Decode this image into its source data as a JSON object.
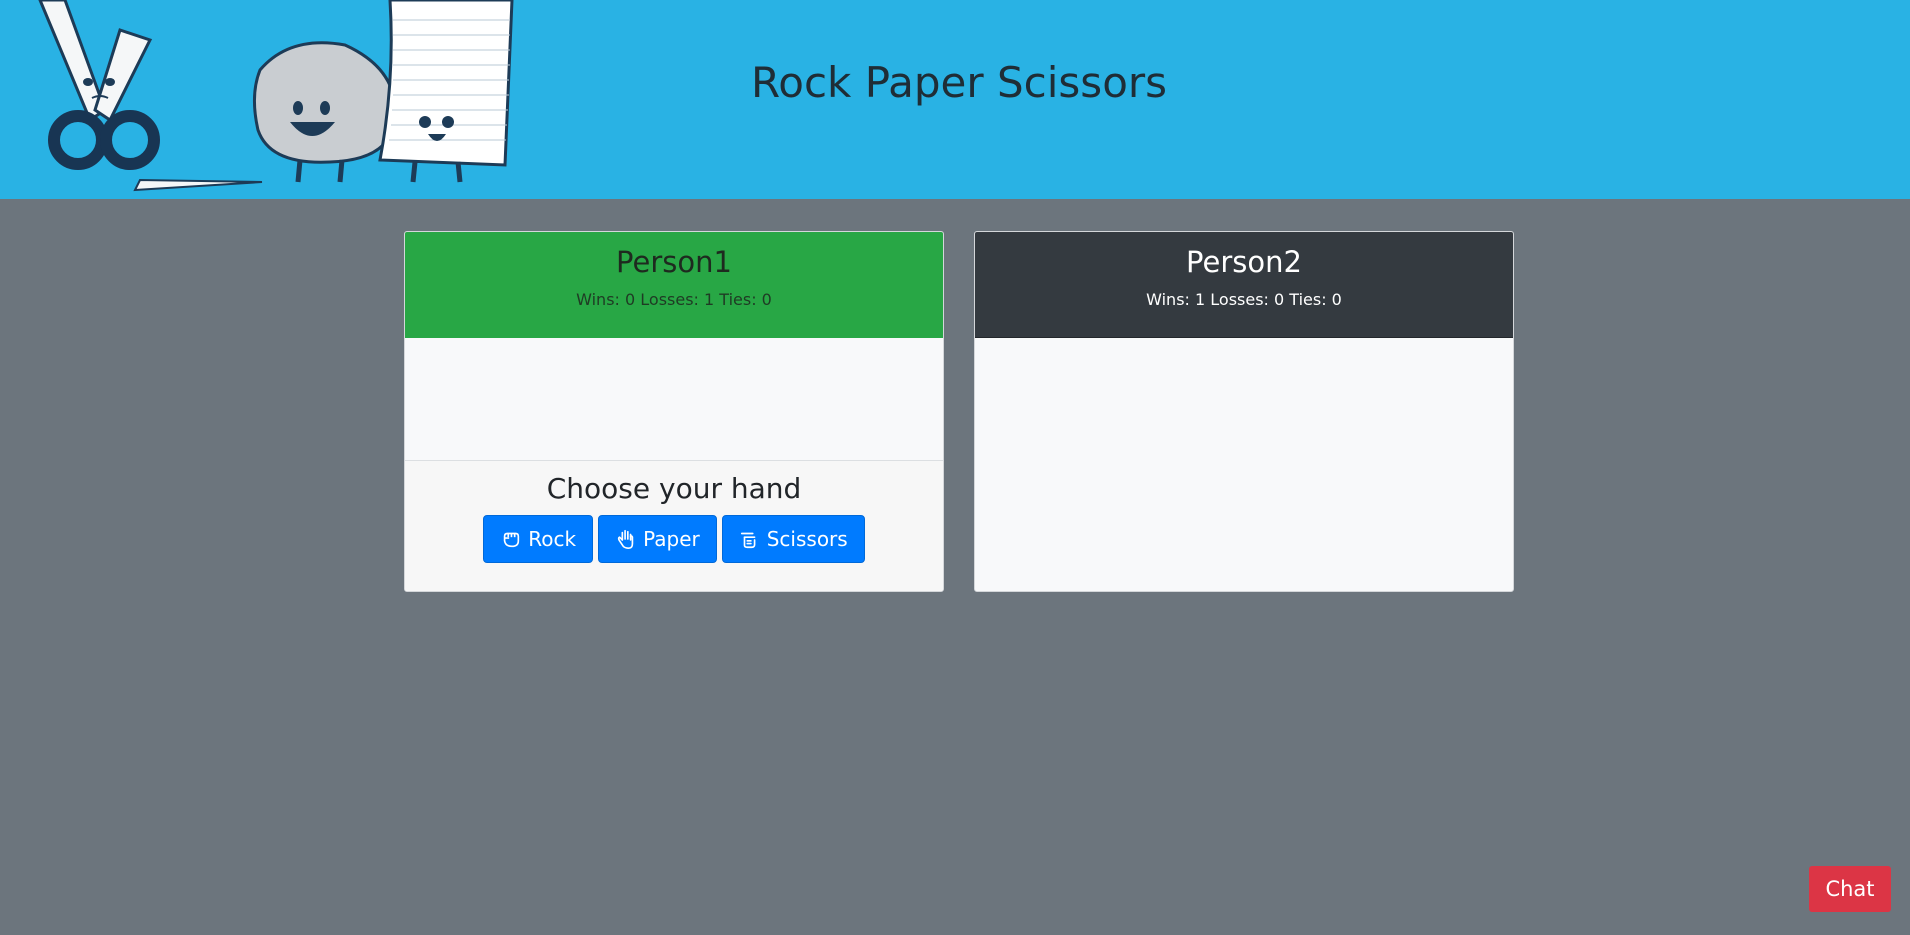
{
  "header": {
    "title": "Rock Paper Scissors",
    "background": "#29b2e4",
    "art_icon": "rock-paper-scissors-characters-illustration"
  },
  "players": [
    {
      "name": "Person1",
      "stats": "Wins: 0 Losses: 1 Ties: 0",
      "header_color": "#28a745"
    },
    {
      "name": "Person2",
      "stats": "Wins: 1 Losses: 0 Ties: 0",
      "header_color": "#343a40"
    }
  ],
  "choose": {
    "title": "Choose your hand",
    "buttons": [
      {
        "label": "Rock",
        "icon": "fist-icon"
      },
      {
        "label": "Paper",
        "icon": "open-hand-icon"
      },
      {
        "label": "Scissors",
        "icon": "scissors-hand-icon"
      }
    ]
  },
  "chat": {
    "label": "Chat",
    "color": "#dc3545"
  },
  "colors": {
    "page_bg": "#6c757d",
    "button": "#007bff"
  }
}
